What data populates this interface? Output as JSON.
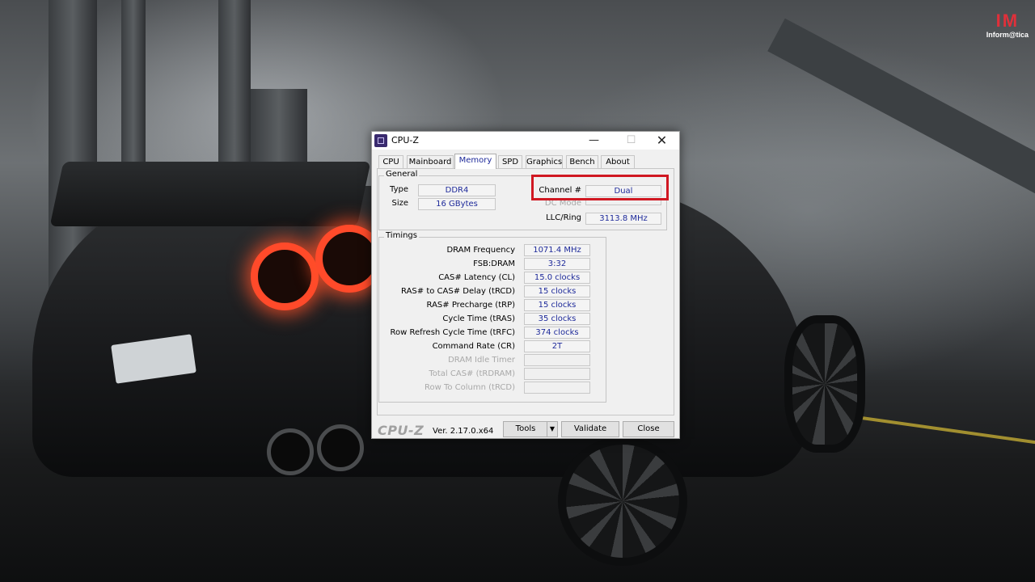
{
  "brand": {
    "logo": "IM",
    "name": "Inform@tica"
  },
  "window": {
    "title": "CPU-Z",
    "controls": {
      "minimize": "—",
      "maximize": "☐",
      "close": "✕"
    }
  },
  "tabs": [
    "CPU",
    "Mainboard",
    "Memory",
    "SPD",
    "Graphics",
    "Bench",
    "About"
  ],
  "active_tab": "Memory",
  "general": {
    "title": "General",
    "type_label": "Type",
    "type_value": "DDR4",
    "size_label": "Size",
    "size_value": "16 GBytes",
    "channel_label": "Channel #",
    "channel_value": "Dual",
    "dc_mode_label": "DC Mode",
    "dc_mode_value": "",
    "llc_label": "LLC/Ring",
    "llc_value": "3113.8 MHz"
  },
  "timings": {
    "title": "Timings",
    "rows": [
      {
        "label": "DRAM Frequency",
        "value": "1071.4 MHz",
        "enabled": true
      },
      {
        "label": "FSB:DRAM",
        "value": "3:32",
        "enabled": true
      },
      {
        "label": "CAS# Latency (CL)",
        "value": "15.0 clocks",
        "enabled": true
      },
      {
        "label": "RAS# to CAS# Delay (tRCD)",
        "value": "15 clocks",
        "enabled": true
      },
      {
        "label": "RAS# Precharge (tRP)",
        "value": "15 clocks",
        "enabled": true
      },
      {
        "label": "Cycle Time (tRAS)",
        "value": "35 clocks",
        "enabled": true
      },
      {
        "label": "Row Refresh Cycle Time (tRFC)",
        "value": "374 clocks",
        "enabled": true
      },
      {
        "label": "Command Rate (CR)",
        "value": "2T",
        "enabled": true
      },
      {
        "label": "DRAM Idle Timer",
        "value": "",
        "enabled": false
      },
      {
        "label": "Total CAS# (tRDRAM)",
        "value": "",
        "enabled": false
      },
      {
        "label": "Row To Column (tRCD)",
        "value": "",
        "enabled": false
      }
    ]
  },
  "footer": {
    "logo": "CPU-Z",
    "version": "Ver. 2.17.0.x64",
    "tools_label": "Tools",
    "tools_arrow": "▼",
    "validate_label": "Validate",
    "close_label": "Close"
  },
  "colors": {
    "value_text": "#1e2a9a",
    "highlight": "#d01822",
    "brand_red": "#e0303a"
  }
}
